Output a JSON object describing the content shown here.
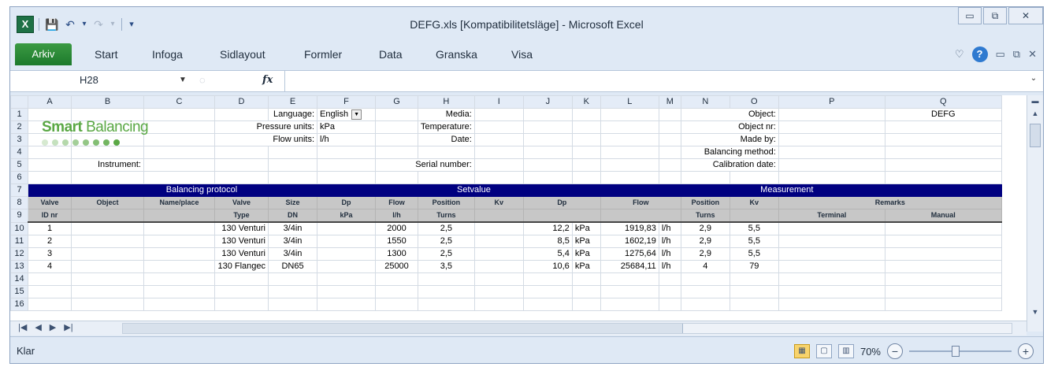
{
  "window": {
    "title": "DEFG.xls  [Kompatibilitetsläge]  -  Microsoft Excel",
    "buttons": {
      "minimize": "▭",
      "restore": "⧉",
      "close": "✕"
    }
  },
  "qat": {
    "logo": "X",
    "save": "💾",
    "undo": "↶",
    "undo_dd": "▾",
    "redo": "↷",
    "redo_dd": "▾",
    "customize": "▾"
  },
  "ribbon": {
    "tabs": [
      "Arkiv",
      "Start",
      "Infoga",
      "Sidlayout",
      "Formler",
      "Data",
      "Granska",
      "Visa"
    ],
    "right": {
      "collapse": "♡",
      "help": "?",
      "min": "▭",
      "restore": "⧉",
      "close": "✕"
    }
  },
  "formula_bar": {
    "name_box": "H28",
    "fx": "fx",
    "formula": ""
  },
  "columns": [
    "A",
    "B",
    "C",
    "D",
    "E",
    "F",
    "G",
    "H",
    "I",
    "J",
    "K",
    "L",
    "M",
    "N",
    "O",
    "P",
    "Q"
  ],
  "rows": [
    "1",
    "2",
    "3",
    "4",
    "5",
    "6",
    "7",
    "8",
    "9",
    "10",
    "11",
    "12",
    "13",
    "14",
    "15",
    "16"
  ],
  "logo": {
    "bold": "Smart",
    "rest": " Balancing"
  },
  "form": {
    "language_label": "Language:",
    "language_value": "English",
    "pressure_label": "Pressure units:",
    "pressure_value": "kPa",
    "flow_label": "Flow units:",
    "flow_value": "l/h",
    "instrument_label": "Instrument:",
    "media_label": "Media:",
    "temperature_label": "Temperature:",
    "date_label": "Date:",
    "serial_label": "Serial number:",
    "object_label": "Object:",
    "object_value": "DEFG",
    "objectnr_label": "Object nr:",
    "madeby_label": "Made by:",
    "method_label": "Balancing method:",
    "calibration_label": "Calibration date:"
  },
  "sections": {
    "protocol": "Balancing protocol",
    "setvalue": "Setvalue",
    "measurement": "Measurement"
  },
  "headers": {
    "valve": "Valve",
    "id_nr": "ID nr",
    "object": "Object",
    "name_place": "Name/place",
    "valve2": "Valve",
    "type": "Type",
    "size": "Size",
    "dn": "DN",
    "dp": "Dp",
    "kpa": "kPa",
    "flow": "Flow",
    "lh": "l/h",
    "position": "Position",
    "turns": "Turns",
    "kv": "Kv",
    "m_dp": "Dp",
    "m_flow": "Flow",
    "m_position": "Position",
    "m_turns": "Turns",
    "m_kv": "Kv",
    "remarks": "Remarks",
    "terminal": "Terminal",
    "manual": "Manual"
  },
  "valves": [
    {
      "id": "1",
      "type": "130 Venturi",
      "size": "3/4in",
      "flow": "2000",
      "position": "2,5",
      "m_dp": "12,2",
      "m_dp_unit": "kPa",
      "m_flow": "1919,83",
      "m_flow_unit": "l/h",
      "m_position": "2,9",
      "m_kv": "5,5"
    },
    {
      "id": "2",
      "type": "130 Venturi",
      "size": "3/4in",
      "flow": "1550",
      "position": "2,5",
      "m_dp": "8,5",
      "m_dp_unit": "kPa",
      "m_flow": "1602,19",
      "m_flow_unit": "l/h",
      "m_position": "2,9",
      "m_kv": "5,5"
    },
    {
      "id": "3",
      "type": "130 Venturi",
      "size": "3/4in",
      "flow": "1300",
      "position": "2,5",
      "m_dp": "5,4",
      "m_dp_unit": "kPa",
      "m_flow": "1275,64",
      "m_flow_unit": "l/h",
      "m_position": "2,9",
      "m_kv": "5,5"
    },
    {
      "id": "4",
      "type": "130 Flangec",
      "size": "DN65",
      "flow": "25000",
      "position": "3,5",
      "m_dp": "10,6",
      "m_dp_unit": "kPa",
      "m_flow": "25684,11",
      "m_flow_unit": "l/h",
      "m_position": "4",
      "m_kv": "79"
    }
  ],
  "sheet_nav": {
    "first": "|◀",
    "prev": "◀",
    "next": "▶",
    "last": "▶|"
  },
  "status": {
    "ready": "Klar",
    "zoom": "70%",
    "zoom_level": 0.45
  },
  "colors": {
    "band": "#000080",
    "header_gray": "#c7c7c7",
    "logo_green": "#5aa845",
    "file_tab": "#1d7a2c"
  }
}
